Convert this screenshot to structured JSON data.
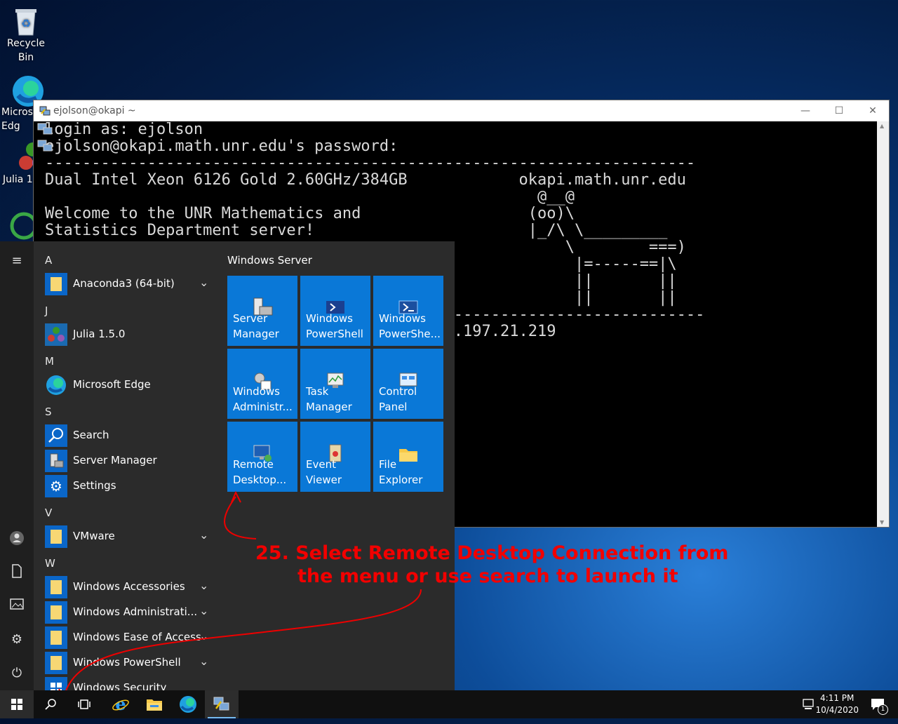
{
  "desktop": {
    "icons": [
      {
        "label": "Recycle\nBin"
      },
      {
        "label": "Micros\nEdg"
      },
      {
        "label": "Julia 1"
      }
    ]
  },
  "putty": {
    "title": "ejolson@okapi ~",
    "terminal_lines": [
      "login as: ejolson",
      "ejolson@okapi.math.unr.edu's password:",
      "----------------------------------------------------------------------",
      "Dual Intel Xeon 6126 Gold 2.60GHz/384GB            okapi.math.unr.edu",
      "                                                     @__@",
      "Welcome to the UNR Mathematics and                  (oo)\\",
      "Statistics Department server!                       |_/\\ \\_________",
      "                                                        \\        ===)",
      "                                                         |=-----==|\\",
      "                                                         ||       ||",
      "                                                         ||       ||",
      "-----------------------------------------------------------------------",
      "                                       m 134.197.21.219"
    ]
  },
  "start_menu": {
    "letters": [
      "A",
      "J",
      "M",
      "S",
      "V",
      "W"
    ],
    "apps": {
      "anaconda": "Anaconda3 (64-bit)",
      "julia": "Julia 1.5.0",
      "edge": "Microsoft Edge",
      "search": "Search",
      "server_manager": "Server Manager",
      "settings": "Settings",
      "vmware": "VMware",
      "win_accessories": "Windows Accessories",
      "win_admin": "Windows Administrati...",
      "win_ease": "Windows Ease of Access",
      "win_powershell": "Windows PowerShell",
      "win_security": "Windows Security"
    },
    "group_title": "Windows Server",
    "tiles": [
      "Server\nManager",
      "Windows\nPowerShell",
      "Windows\nPowerShe...",
      "Windows\nAdministr...",
      "Task\nManager",
      "Control\nPanel",
      "Remote\nDesktop...",
      "Event\nViewer",
      "File\nExplorer"
    ]
  },
  "annotation": {
    "line1": "25. Select Remote Desktop Connection from",
    "line2": "the menu or use search to launch it",
    "color": "#f20000"
  },
  "taskbar": {
    "time": "4:11 PM",
    "date": "10/4/2020",
    "notification_count": "1"
  }
}
